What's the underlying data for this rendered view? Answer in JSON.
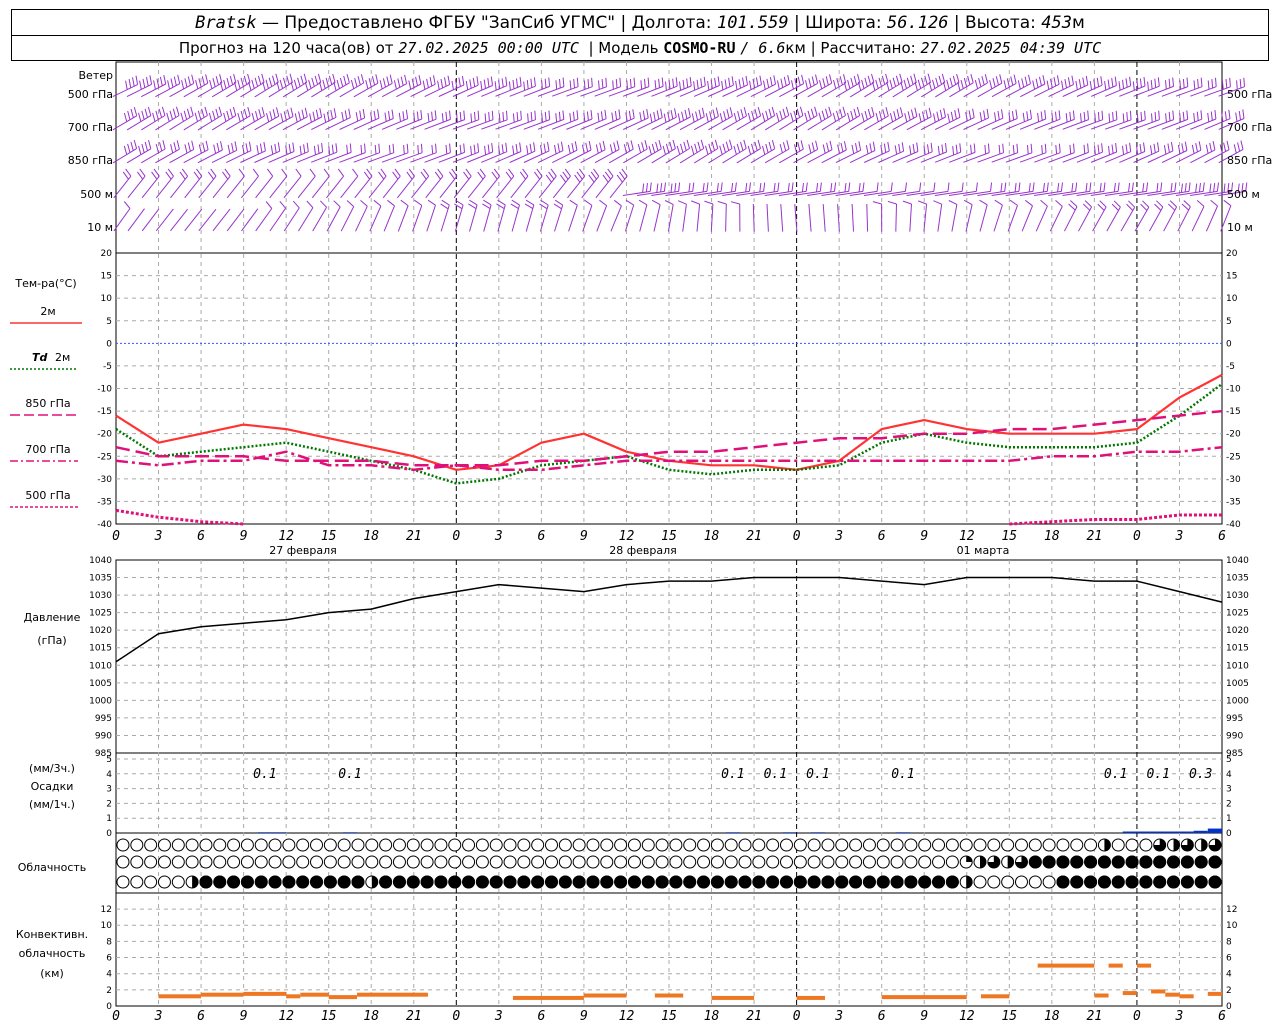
{
  "header": {
    "station": "Bratsk",
    "dash": "—",
    "provider": "Предоставлено ФГБУ \"ЗапСиб УГМС\"",
    "lon_label": "Долгота:",
    "lon": "101.559",
    "lat_label": "Широта:",
    "lat": "56.126",
    "alt_label": "Высота:",
    "alt": "453",
    "alt_unit": "м",
    "forecast_label": "Прогноз на 120 часа(ов) от",
    "forecast_start": "27.02.2025 00:00 UTC",
    "model_label": "Модель",
    "model": "COSMO-RU",
    "model_res": "/ 6.6",
    "model_res_unit": "км",
    "calc_label": "Рассчитано:",
    "calc_time": "27.02.2025 04:39 UTC"
  },
  "labels": {
    "wind": "Ветер",
    "wind_levels": [
      "500 гПа",
      "700 гПа",
      "850 гПа",
      "500 м",
      "10 м"
    ],
    "temp_title": "Тем-ра(°C)",
    "t2m": "2м",
    "td_sym": "Td",
    "td_2m": "2м",
    "l850": "850 гПа",
    "l700": "700 гПа",
    "l500": "500 гПа",
    "pressure": "Давление",
    "pressure_unit": "(гПа)",
    "precip_top": "(мм/3ч.)",
    "precip": "Осадки",
    "precip_bottom": "(мм/1ч.)",
    "cloud": "Облачность",
    "conv1": "Конвективн.",
    "conv2": "облачность",
    "conv3": "(км)",
    "date1": "27 февраля",
    "date2": "28 февраля",
    "date3": "01 марта"
  },
  "colors": {
    "t2m": "#ff3333",
    "td": "#007700",
    "p850": "#e0107a",
    "p700": "#e0107a",
    "p500": "#e0107a",
    "wind": "#9933cc",
    "pressure": "#000000",
    "precip": "#0033cc",
    "conv": "#ee7722",
    "zero": "#3355ff"
  },
  "chart_data": [
    {
      "type": "line",
      "name": "wind",
      "levels": [
        "500 гПа",
        "700 гПа",
        "850 гПа",
        "500 м",
        "10 м"
      ],
      "note": "wind barbs each hour; strong westerly aloft"
    },
    {
      "type": "line",
      "name": "temperature",
      "x_ticks": [
        "0",
        "3",
        "6",
        "9",
        "12",
        "15",
        "18",
        "21",
        "0",
        "3",
        "6",
        "9",
        "12",
        "15",
        "18",
        "21",
        "0",
        "3",
        "6",
        "9",
        "12",
        "15",
        "18",
        "21",
        "0",
        "3",
        "6"
      ],
      "y_ticks": [
        20,
        15,
        10,
        5,
        0,
        -5,
        -10,
        -15,
        -20,
        -25,
        -30,
        -35,
        -40
      ],
      "ylim": [
        -40,
        20
      ],
      "hours": [
        0,
        3,
        6,
        9,
        12,
        15,
        18,
        21,
        24,
        27,
        30,
        33,
        36,
        39,
        42,
        45,
        48,
        51,
        54,
        57,
        60,
        63,
        66,
        69,
        72,
        75,
        78
      ],
      "series": [
        {
          "key": "t2m",
          "values": [
            -16,
            -22,
            -20,
            -18,
            -19,
            -21,
            -23,
            -25,
            -28,
            -27,
            -22,
            -20,
            -24,
            -26,
            -27,
            -27,
            -28,
            -26,
            -19,
            -17,
            -19,
            -20,
            -20,
            -20,
            -19,
            -12,
            -7
          ]
        },
        {
          "key": "td",
          "values": [
            -19,
            -25,
            -24,
            -23,
            -22,
            -24,
            -26,
            -28,
            -31,
            -30,
            -27,
            -26,
            -25,
            -28,
            -29,
            -28,
            -28,
            -27,
            -22,
            -20,
            -22,
            -23,
            -23,
            -23,
            -22,
            -16,
            -9
          ]
        },
        {
          "key": "p850",
          "values": [
            -23,
            -25,
            -25,
            -25,
            -26,
            -26,
            -26,
            -27,
            -27,
            -27,
            -26,
            -26,
            -25,
            -24,
            -24,
            -23,
            -22,
            -21,
            -21,
            -20,
            -20,
            -19,
            -19,
            -18,
            -17,
            -16,
            -15
          ]
        },
        {
          "key": "p700",
          "values": [
            -26,
            -27,
            -26,
            -26,
            -24,
            -27,
            -27,
            -28,
            -27,
            -28,
            -28,
            -27,
            -26,
            -26,
            -26,
            -26,
            -26,
            -26,
            -26,
            -26,
            -26,
            -26,
            -25,
            -25,
            -24,
            -24,
            -23
          ]
        },
        {
          "key": "p500",
          "values": [
            -37,
            -38.5,
            -39.5,
            -40,
            null,
            null,
            null,
            null,
            null,
            null,
            null,
            null,
            null,
            null,
            null,
            null,
            null,
            null,
            null,
            null,
            null,
            -40,
            -39.5,
            -39,
            -39,
            -38,
            -38
          ]
        }
      ]
    },
    {
      "type": "line",
      "name": "pressure",
      "y_ticks": [
        1040,
        1035,
        1030,
        1025,
        1020,
        1015,
        1010,
        1005,
        1000,
        995,
        990,
        985
      ],
      "ylim": [
        985,
        1040
      ],
      "hours": [
        0,
        3,
        6,
        9,
        12,
        15,
        18,
        21,
        24,
        27,
        30,
        33,
        36,
        39,
        42,
        45,
        48,
        51,
        54,
        57,
        60,
        63,
        66,
        69,
        72,
        75,
        78
      ],
      "values": [
        1011,
        1019,
        1021,
        1022,
        1023,
        1025,
        1026,
        1029,
        1031,
        1033,
        1032,
        1031,
        1033,
        1034,
        1034,
        1035,
        1035,
        1035,
        1034,
        1033,
        1035,
        1035,
        1035,
        1034,
        1034,
        1031,
        1028
      ]
    },
    {
      "type": "bar",
      "name": "precipitation",
      "y_ticks": [
        5,
        4,
        3,
        2,
        1,
        0
      ],
      "ylim": [
        0,
        5
      ],
      "labels": [
        {
          "hour": 10.5,
          "text": "0.1"
        },
        {
          "hour": 16.5,
          "text": "0.1"
        },
        {
          "hour": 43.5,
          "text": "0.1"
        },
        {
          "hour": 46.5,
          "text": "0.1"
        },
        {
          "hour": 49.5,
          "text": "0.1"
        },
        {
          "hour": 55.5,
          "text": "0.1"
        },
        {
          "hour": 70.5,
          "text": "0.1"
        },
        {
          "hour": 73.5,
          "text": "0.1"
        },
        {
          "hour": 76.5,
          "text": "0.3"
        }
      ],
      "bars": [
        {
          "from": 10,
          "to": 12,
          "value": 0.05
        },
        {
          "from": 16,
          "to": 17,
          "value": 0.05
        },
        {
          "from": 43,
          "to": 44,
          "value": 0.05
        },
        {
          "from": 47,
          "to": 48,
          "value": 0.05
        },
        {
          "from": 49,
          "to": 50,
          "value": 0.05
        },
        {
          "from": 55,
          "to": 56,
          "value": 0.05
        },
        {
          "from": 71,
          "to": 76,
          "value": 0.1
        },
        {
          "from": 76,
          "to": 77,
          "value": 0.15
        },
        {
          "from": 77,
          "to": 78,
          "value": 0.3
        }
      ]
    },
    {
      "type": "heatmap",
      "name": "cloudiness",
      "rows": 3,
      "values": [
        [
          0,
          0,
          0,
          0,
          0,
          0,
          0,
          0,
          0,
          0,
          0,
          0,
          0,
          0,
          0,
          0,
          0,
          0,
          0,
          0,
          0,
          0,
          0,
          0,
          0,
          0,
          0,
          0,
          0,
          0,
          0,
          0,
          0,
          0,
          0,
          0,
          0,
          0,
          0,
          0,
          0,
          0,
          0,
          0,
          0,
          0,
          0,
          0,
          0,
          0,
          0,
          0,
          0,
          0,
          0,
          0,
          0,
          0,
          0,
          0,
          0,
          0,
          0,
          0,
          0,
          0,
          0,
          0,
          0,
          0,
          0,
          0.5,
          0,
          0,
          0,
          0.75,
          0.5,
          0.75,
          0.5,
          0.75
        ],
        [
          0,
          0,
          0,
          0,
          0,
          0,
          0,
          0,
          0,
          0,
          0,
          0,
          0,
          0,
          0,
          0,
          0,
          0,
          0,
          0,
          0,
          0,
          0,
          0,
          0,
          0,
          0,
          0,
          0,
          0,
          0,
          0,
          0,
          0,
          0,
          0,
          0,
          0,
          0,
          0,
          0,
          0,
          0,
          0,
          0,
          0,
          0,
          0,
          0,
          0,
          0,
          0,
          0,
          0,
          0,
          0,
          0,
          0,
          0,
          0,
          0,
          0.25,
          0.5,
          0.75,
          0.5,
          0.75,
          1,
          1,
          1,
          1,
          1,
          1,
          1,
          1,
          1,
          1,
          1,
          1,
          1,
          1
        ],
        [
          0,
          0,
          0,
          0,
          0,
          0.5,
          1,
          1,
          1,
          1,
          1,
          1,
          1,
          1,
          1,
          1,
          1,
          1,
          0.5,
          1,
          1,
          1,
          1,
          1,
          1,
          1,
          1,
          1,
          1,
          1,
          1,
          1,
          1,
          1,
          1,
          1,
          1,
          1,
          1,
          1,
          1,
          1,
          1,
          1,
          1,
          1,
          1,
          1,
          1,
          1,
          1,
          1,
          1,
          1,
          1,
          1,
          1,
          1,
          1,
          1,
          1,
          0.5,
          0,
          0,
          0,
          0,
          0,
          0,
          1,
          1,
          1,
          1,
          1,
          1,
          1,
          1,
          1,
          1,
          1,
          1
        ]
      ]
    },
    {
      "type": "bar",
      "name": "convective",
      "y_ticks": [
        12,
        10,
        8,
        6,
        4,
        2,
        0
      ],
      "ylim": [
        0,
        13
      ],
      "segments": [
        {
          "from": 3,
          "to": 6,
          "value": 1.2
        },
        {
          "from": 6,
          "to": 9,
          "value": 1.4
        },
        {
          "from": 9,
          "to": 12,
          "value": 1.5
        },
        {
          "from": 12,
          "to": 13,
          "value": 1.2
        },
        {
          "from": 13,
          "to": 15,
          "value": 1.4
        },
        {
          "from": 15,
          "to": 17,
          "value": 1.1
        },
        {
          "from": 17,
          "to": 22,
          "value": 1.4
        },
        {
          "from": 28,
          "to": 33,
          "value": 1.0
        },
        {
          "from": 33,
          "to": 36,
          "value": 1.3
        },
        {
          "from": 38,
          "to": 40,
          "value": 1.3
        },
        {
          "from": 42,
          "to": 45,
          "value": 1.0
        },
        {
          "from": 48,
          "to": 50,
          "value": 1.0
        },
        {
          "from": 54,
          "to": 60,
          "value": 1.1
        },
        {
          "from": 61,
          "to": 63,
          "value": 1.2
        },
        {
          "from": 65,
          "to": 69,
          "value": 5.0
        },
        {
          "from": 69,
          "to": 70,
          "value": 1.3
        },
        {
          "from": 70,
          "to": 71,
          "value": 5.0
        },
        {
          "from": 71,
          "to": 72,
          "value": 1.6
        },
        {
          "from": 72,
          "to": 73,
          "value": 5.0
        },
        {
          "from": 73,
          "to": 74,
          "value": 1.8
        },
        {
          "from": 74,
          "to": 75,
          "value": 1.4
        },
        {
          "from": 75,
          "to": 76,
          "value": 1.2
        },
        {
          "from": 77,
          "to": 78,
          "value": 1.5
        }
      ]
    }
  ]
}
